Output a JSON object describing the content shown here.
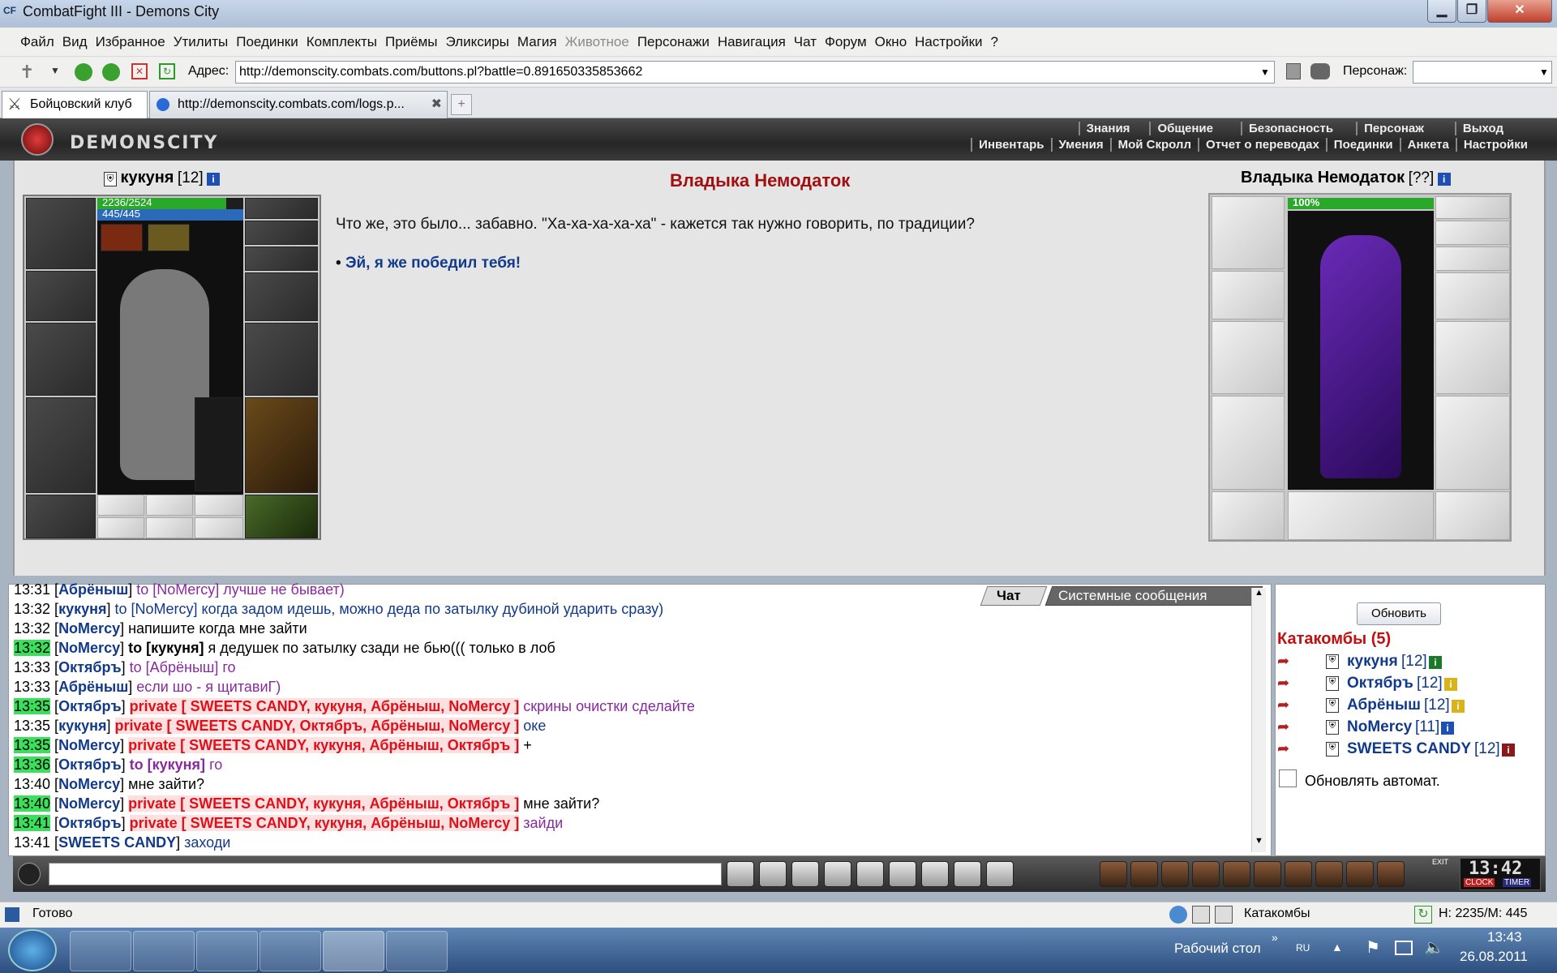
{
  "window": {
    "title": "CombatFight III - Demons City",
    "app_icon": "CF",
    "min": "▁",
    "max": "❐",
    "close": "✕"
  },
  "menu": [
    "Файл",
    "Вид",
    "Избранное",
    "Утилиты",
    "Поединки",
    "Комплекты",
    "Приёмы",
    "Эликсиры",
    "Магия",
    "Животное",
    "Персонажи",
    "Навигация",
    "Чат",
    "Форум",
    "Окно",
    "Настройки",
    "?"
  ],
  "addressbar": {
    "label": "Адрес:",
    "url": "http://demonscity.combats.com/buttons.pl?battle=0.891650335853662",
    "person_label": "Персонаж:"
  },
  "tabs": [
    {
      "label": "Бойцовский клуб"
    },
    {
      "label": "http://demonscity.combats.com/logs.p..."
    }
  ],
  "game": {
    "logo": "DEMONSCITY",
    "nav_top": [
      "Знания",
      "Общение",
      "Безопасность",
      "Персонаж",
      "Выход"
    ],
    "nav_bottom": [
      "Инвентарь",
      "Умения",
      "Мой Скролл",
      "Отчет о переводах",
      "Поединки",
      "Анкета",
      "Настройки"
    ]
  },
  "player": {
    "name": "кукуня",
    "level": "[12]",
    "hp": "2236/2524",
    "mana": "445/445",
    "hp_fraction": 0.886
  },
  "npc": {
    "title": "Владыка Немодаток",
    "name": "Владыка Немодаток",
    "level": "[??]",
    "hp_label": "100%",
    "hp_fraction": 1.0
  },
  "dialog": {
    "text": "Что же, это было... забавно. \"Ха-ха-ха-ха-ха\" - кажется так нужно говорить, по традиции?",
    "option": "Эй, я же победил тебя!"
  },
  "chat": {
    "tab_chat": "Чат",
    "tab_system": "Системные сообщения",
    "lines": [
      {
        "time": "13:31",
        "hl": false,
        "nick": "Абрёныш",
        "parts": [
          {
            "c": "purple",
            "t": "to [NoMercy] лучше не бывает)"
          }
        ]
      },
      {
        "time": "13:32",
        "hl": false,
        "nick": "кукуня",
        "parts": [
          {
            "c": "blue",
            "t": "to [NoMercy] когда задом идешь, можно деда по затылку дубиной ударить сразу)"
          }
        ]
      },
      {
        "time": "13:32",
        "hl": false,
        "nick": "NoMercy",
        "parts": [
          {
            "c": "black",
            "t": "напишите когда мне зайти"
          }
        ]
      },
      {
        "time": "13:32",
        "hl": true,
        "nick": "NoMercy",
        "parts": [
          {
            "c": "tokuk",
            "t": "to [кукуня]"
          },
          {
            "c": "black",
            "t": " я дедушек по затылку сзади не бью((( только в лоб"
          }
        ]
      },
      {
        "time": "13:33",
        "hl": false,
        "nick": "Октябръ",
        "parts": [
          {
            "c": "purple",
            "t": "to [Абрёныш] го"
          }
        ]
      },
      {
        "time": "13:33",
        "hl": false,
        "nick": "Абрёныш",
        "parts": [
          {
            "c": "purple",
            "t": "если шо - я щитавиГ)"
          }
        ]
      },
      {
        "time": "13:35",
        "hl": true,
        "nick": "Октябръ",
        "parts": [
          {
            "c": "priv",
            "t": "private [ SWEETS CANDY, кукуня, Абрёныш, NoMercy ]"
          },
          {
            "c": "purple",
            "t": " скрины очистки сделайте"
          }
        ]
      },
      {
        "time": "13:35",
        "hl": false,
        "nick": "кукуня",
        "parts": [
          {
            "c": "priv",
            "t": "private [ SWEETS CANDY, Октябръ, Абрёныш, NoMercy ]"
          },
          {
            "c": "blue",
            "t": " оке"
          }
        ]
      },
      {
        "time": "13:35",
        "hl": true,
        "nick": "NoMercy",
        "parts": [
          {
            "c": "priv",
            "t": "private [ SWEETS CANDY, кукуня, Абрёныш, Октябръ ]"
          },
          {
            "c": "black",
            "t": " +"
          }
        ]
      },
      {
        "time": "13:36",
        "hl": true,
        "nick": "Октябръ",
        "parts": [
          {
            "c": "tokuk2",
            "t": "to [кукуня]"
          },
          {
            "c": "purple",
            "t": " го"
          }
        ]
      },
      {
        "time": "13:40",
        "hl": false,
        "nick": "NoMercy",
        "parts": [
          {
            "c": "black",
            "t": "мне зайти?"
          }
        ]
      },
      {
        "time": "13:40",
        "hl": true,
        "nick": "NoMercy",
        "parts": [
          {
            "c": "priv",
            "t": "private [ SWEETS CANDY, кукуня, Абрёныш, Октябръ ]"
          },
          {
            "c": "black",
            "t": " мне зайти?"
          }
        ]
      },
      {
        "time": "13:41",
        "hl": true,
        "nick": "Октябръ",
        "parts": [
          {
            "c": "priv",
            "t": "private [ SWEETS CANDY, кукуня, Абрёныш, NoMercy ]"
          },
          {
            "c": "purple",
            "t": " зайди"
          }
        ]
      },
      {
        "time": "13:41",
        "hl": false,
        "nick": "SWEETS CANDY",
        "parts": [
          {
            "c": "blue",
            "t": "заходи"
          }
        ]
      }
    ]
  },
  "room": {
    "refresh": "Обновить",
    "title": "Катакомбы (5)",
    "players": [
      {
        "name": "кукуня",
        "level": "[12]",
        "info": "green"
      },
      {
        "name": "Октябръ",
        "level": "[12]",
        "info": "gold"
      },
      {
        "name": "Абрёныш",
        "level": "[12]",
        "info": "gold"
      },
      {
        "name": "NoMercy",
        "level": "[11]",
        "info": "blue"
      },
      {
        "name": "SWEETS CANDY",
        "level": "[12]",
        "info": "red"
      }
    ],
    "auto_refresh": "Обновлять автомат."
  },
  "clock": {
    "time": "13:42",
    "clock_label": "CLOCK",
    "timer_label": "TIMER",
    "exit": "EXIT"
  },
  "status": {
    "text": "Готово",
    "location": "Катакомбы",
    "hp_mp": "H: 2235/M: 445"
  },
  "taskbar": {
    "desktop": "Рабочий стол",
    "lang": "RU",
    "time": "13:43",
    "date": "26.08.2011"
  },
  "colors": {
    "npc_title": "#a01010",
    "nick": "#123a8a",
    "private": "#e0101a",
    "time_highlight": "#3adf5a",
    "dialog_option": "#123a8a"
  }
}
